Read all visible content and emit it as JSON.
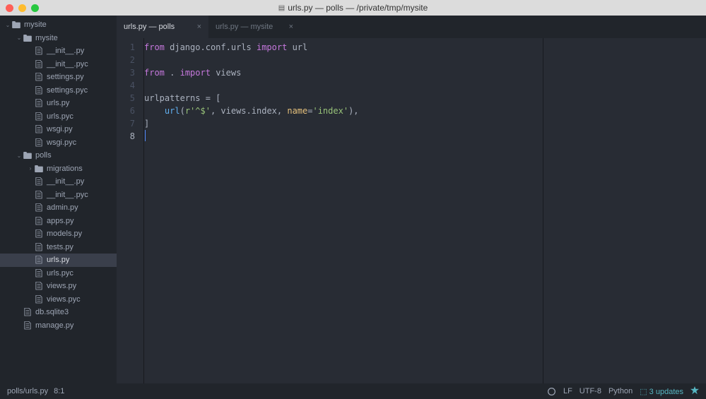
{
  "window": {
    "title": "urls.py — polls — /private/tmp/mysite"
  },
  "sidebar": {
    "tree": [
      {
        "type": "folder",
        "name": "mysite",
        "depth": 0,
        "expanded": true
      },
      {
        "type": "folder",
        "name": "mysite",
        "depth": 1,
        "expanded": true
      },
      {
        "type": "file",
        "name": "__init__.py",
        "depth": 2
      },
      {
        "type": "file",
        "name": "__init__.pyc",
        "depth": 2
      },
      {
        "type": "file",
        "name": "settings.py",
        "depth": 2
      },
      {
        "type": "file",
        "name": "settings.pyc",
        "depth": 2
      },
      {
        "type": "file",
        "name": "urls.py",
        "depth": 2
      },
      {
        "type": "file",
        "name": "urls.pyc",
        "depth": 2
      },
      {
        "type": "file",
        "name": "wsgi.py",
        "depth": 2
      },
      {
        "type": "file",
        "name": "wsgi.pyc",
        "depth": 2
      },
      {
        "type": "folder",
        "name": "polls",
        "depth": 1,
        "expanded": true
      },
      {
        "type": "folder",
        "name": "migrations",
        "depth": 2,
        "expanded": false
      },
      {
        "type": "file",
        "name": "__init__.py",
        "depth": 2
      },
      {
        "type": "file",
        "name": "__init__.pyc",
        "depth": 2
      },
      {
        "type": "file",
        "name": "admin.py",
        "depth": 2
      },
      {
        "type": "file",
        "name": "apps.py",
        "depth": 2
      },
      {
        "type": "file",
        "name": "models.py",
        "depth": 2
      },
      {
        "type": "file",
        "name": "tests.py",
        "depth": 2
      },
      {
        "type": "file",
        "name": "urls.py",
        "depth": 2,
        "selected": true
      },
      {
        "type": "file",
        "name": "urls.pyc",
        "depth": 2
      },
      {
        "type": "file",
        "name": "views.py",
        "depth": 2
      },
      {
        "type": "file",
        "name": "views.pyc",
        "depth": 2
      },
      {
        "type": "file",
        "name": "db.sqlite3",
        "depth": 1
      },
      {
        "type": "file",
        "name": "manage.py",
        "depth": 1
      }
    ]
  },
  "tabs": [
    {
      "label": "urls.py — polls",
      "active": true
    },
    {
      "label": "urls.py — mysite",
      "active": false
    }
  ],
  "editor": {
    "lines": [
      {
        "tokens": [
          [
            "kw",
            "from"
          ],
          [
            "id",
            " django"
          ],
          [
            "op",
            "."
          ],
          [
            "id",
            "conf"
          ],
          [
            "op",
            "."
          ],
          [
            "id",
            "urls "
          ],
          [
            "kw",
            "import"
          ],
          [
            "id",
            " url"
          ]
        ]
      },
      {
        "tokens": []
      },
      {
        "tokens": [
          [
            "kw",
            "from"
          ],
          [
            "id",
            " "
          ],
          [
            "op",
            "."
          ],
          [
            "id",
            " "
          ],
          [
            "kw",
            "import"
          ],
          [
            "id",
            " views"
          ]
        ]
      },
      {
        "tokens": []
      },
      {
        "tokens": [
          [
            "id",
            "urlpatterns "
          ],
          [
            "op",
            "="
          ],
          [
            "id",
            " ["
          ]
        ]
      },
      {
        "tokens": [
          [
            "id",
            "    "
          ],
          [
            "fn",
            "url"
          ],
          [
            "id",
            "("
          ],
          [
            "str",
            "r'^$'"
          ],
          [
            "id",
            ", views"
          ],
          [
            "op",
            "."
          ],
          [
            "id",
            "index, "
          ],
          [
            "cls",
            "name"
          ],
          [
            "op",
            "="
          ],
          [
            "str",
            "'index'"
          ],
          [
            "id",
            "),"
          ]
        ]
      },
      {
        "tokens": [
          [
            "id",
            "]"
          ]
        ]
      },
      {
        "tokens": []
      }
    ],
    "current_line": 8
  },
  "status": {
    "path": "polls/urls.py",
    "cursor": "8:1",
    "encoding_icon": "LF",
    "encoding": "UTF-8",
    "language": "Python",
    "updates": "3 updates"
  }
}
